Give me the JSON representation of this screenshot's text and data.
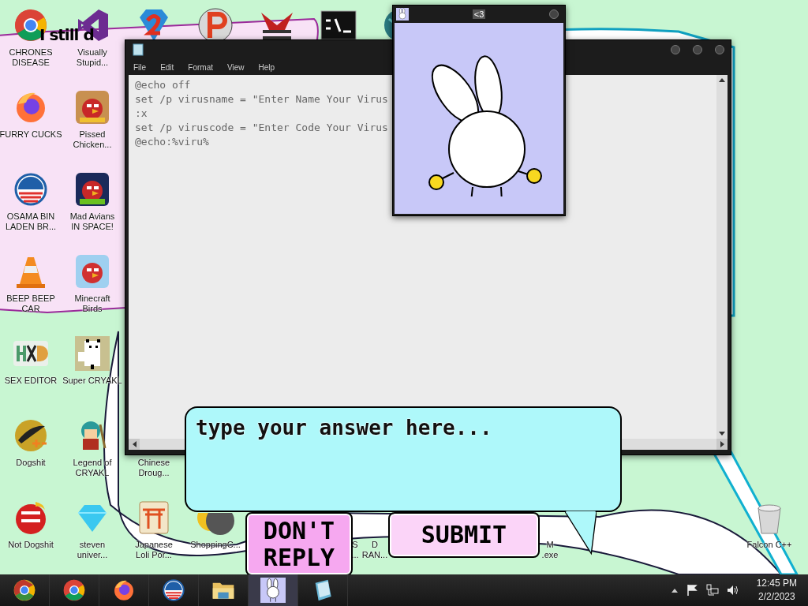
{
  "banner": {
    "text": "I still d"
  },
  "left_icons": [
    {
      "lines": [
        "CHRONES",
        "DISEASE"
      ]
    },
    {
      "lines": [
        "FURRY CUCKS"
      ]
    },
    {
      "lines": [
        "OSAMA BIN",
        "LADEN BR..."
      ]
    },
    {
      "lines": [
        "BEEP BEEP",
        "CAR"
      ]
    },
    {
      "lines": [
        "SEX EDITOR"
      ]
    },
    {
      "lines": [
        "Dogshit"
      ]
    },
    {
      "lines": [
        "Not Dogshit"
      ]
    },
    {
      "lines": [
        "Visually",
        "Stupid..."
      ]
    },
    {
      "lines": [
        "Pissed",
        "Chicken..."
      ]
    },
    {
      "lines": [
        "Mad Avians",
        "IN SPACE!"
      ]
    },
    {
      "lines": [
        "Minecraft",
        "Birds"
      ]
    },
    {
      "lines": [
        "Super CRYAKL"
      ]
    },
    {
      "lines": [
        "Legend of",
        "CRYAKL"
      ]
    },
    {
      "lines": [
        "steven",
        "univer..."
      ]
    }
  ],
  "lower_icons": [
    {
      "lines": [
        "Chinese",
        "Droug..."
      ]
    },
    {
      "lines": [
        "Japanese",
        "Loli Por..."
      ]
    },
    {
      "lines": [
        "ShoppingC..."
      ]
    },
    {
      "lines": [
        "S",
        "..."
      ]
    },
    {
      "lines": [
        "D",
        "RAN..."
      ]
    },
    {
      "lines": [
        "M",
        ".exe"
      ]
    },
    {
      "lines": [
        "Falcon C++"
      ]
    }
  ],
  "notepad": {
    "menu": [
      "File",
      "Edit",
      "Format",
      "View",
      "Help"
    ],
    "lines": [
      "@echo off",
      "set /p virusname = \"Enter Name Your Virus",
      ":x",
      "set /p viruscode = \"Enter Code Your Virus",
      "@echo:%viru%"
    ]
  },
  "bunny_window": {
    "title": "<3"
  },
  "dialog": {
    "placeholder": "type your answer here...",
    "buttons": [
      "DON'T REPLY",
      "SUBMIT"
    ]
  },
  "taskbar": {
    "items": [
      {
        "selected": false
      },
      {
        "selected": false
      },
      {
        "selected": false
      },
      {
        "selected": false
      },
      {
        "selected": false
      },
      {
        "selected": true
      },
      {
        "selected": false
      }
    ],
    "time": "12:45 PM",
    "date": "2/2/2023"
  }
}
